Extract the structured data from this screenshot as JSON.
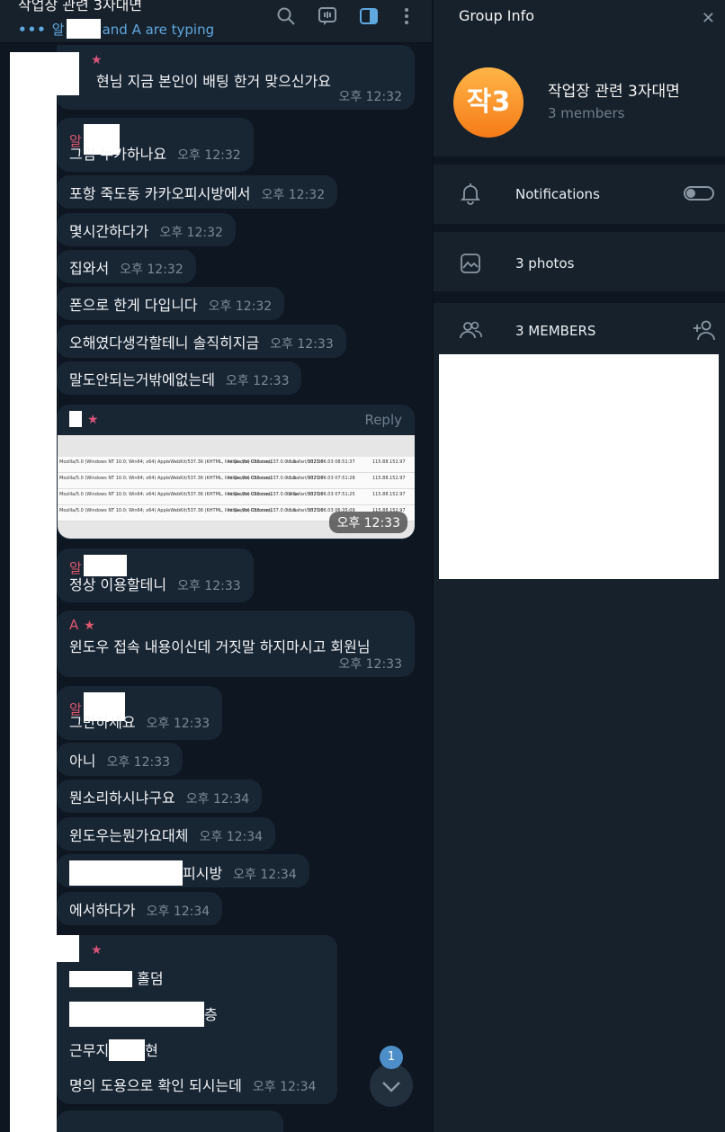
{
  "header": {
    "title": "작업장 관련 3자대면",
    "typing_prefix": "알",
    "typing_suffix": "and A are typing"
  },
  "messages": [
    {
      "text": "현님 지금 본인이 배팅 한거 맞으신가요",
      "time": "오후 12:32"
    },
    {
      "sender": "알",
      "text": "그럼 누가하나요",
      "time": "오후 12:32"
    },
    {
      "text": "포항 죽도동 카카오피시방에서",
      "time": "오후 12:32"
    },
    {
      "text": "몇시간하다가",
      "time": "오후 12:32"
    },
    {
      "text": "집와서",
      "time": "오후 12:32"
    },
    {
      "text": "폰으로 한게 다입니다",
      "time": "오후 12:32"
    },
    {
      "text": "오해였다생각할테니 솔직히지금",
      "time": "오후 12:33"
    },
    {
      "text": "말도안되는거밖에없는데",
      "time": "오후 12:33"
    },
    {
      "reply_label": "Reply",
      "time": "오후 12:33"
    },
    {
      "sender": "알",
      "text": "정상 이용할테니",
      "time": "오후 12:33"
    },
    {
      "sender": "A",
      "text": "윈도우 접속 내용이신데 거짓말 하지마시고 회원님",
      "time": "오후 12:33"
    },
    {
      "sender": "알",
      "text": "그만하세요",
      "time": "오후 12:33"
    },
    {
      "text": "아니",
      "time": "오후 12:33"
    },
    {
      "text": "뭔소리하시냐구요",
      "time": "오후 12:34"
    },
    {
      "text": "윈도우는뭔가요대체",
      "time": "오후 12:34"
    },
    {
      "text": "피시방",
      "time": "오후 12:34"
    },
    {
      "text": "에서하다가",
      "time": "오후 12:34"
    },
    {
      "line1": "홀덤",
      "line2": "층",
      "line3_a": "근무지",
      "line3_b": "현",
      "line4": "명의 도용으로 확인 되시는데",
      "time": "오후 12:34"
    }
  ],
  "photo_rows": [
    {
      "ua": "Mozilla/5.0 (Windows NT 10.0; Win64; x64) AppleWebKit/537.36 (KHTML, like Gecko) Chrome/137.0.0.0 Safari/537.36",
      "url": "https://ht-033.com/",
      "flag": "true",
      "date": "2025.06.03 08:51:37",
      "ip": "115.88.152.97"
    },
    {
      "ua": "Mozilla/5.0 (Windows NT 10.0; Win64; x64) AppleWebKit/537.36 (KHTML, like Gecko) Chrome/137.0.0.0 Safari/537.36",
      "url": "https://ht-033.com/",
      "flag": "true",
      "date": "2025.06.03 07:51:28",
      "ip": "115.88.152.97"
    },
    {
      "ua": "Mozilla/5.0 (Windows NT 10.0; Win64; x64) AppleWebKit/537.36 (KHTML, like Gecko) Chrome/137.0.0.0 Safari/537.36",
      "url": "https://ht-033.com/",
      "flag": "false",
      "date": "2025.06.03 07:51:25",
      "ip": "115.88.152.97"
    },
    {
      "ua": "Mozilla/5.0 (Windows NT 10.0; Win64; x64) AppleWebKit/537.36 (KHTML, like Gecko) Chrome/137.0.0.0 Safari/537.36",
      "url": "https://ht-033.com/",
      "flag": "true",
      "date": "2025.06.03 06:35:09",
      "ip": "115.88.152.97"
    }
  ],
  "unread_count": "1",
  "info": {
    "title": "Group Info",
    "avatar_text": "작3",
    "group_name": "작업장 관련 3자대면",
    "member_count": "3 members",
    "notifications_label": "Notifications",
    "photos_label": "3 photos",
    "members_header": "3 MEMBERS"
  },
  "colors": {
    "background": "#0e1621",
    "panel": "#17212b",
    "bubble": "#182533",
    "accent": "#5fa8e0",
    "sender_red": "#e0576d",
    "avatar_orange": "#f57b18"
  },
  "icons": [
    "search-icon",
    "voice-chat-icon",
    "sidebar-toggle-icon",
    "more-icon",
    "close-icon",
    "bell-icon",
    "photos-icon",
    "members-icon",
    "add-member-icon",
    "chevron-down-icon"
  ]
}
